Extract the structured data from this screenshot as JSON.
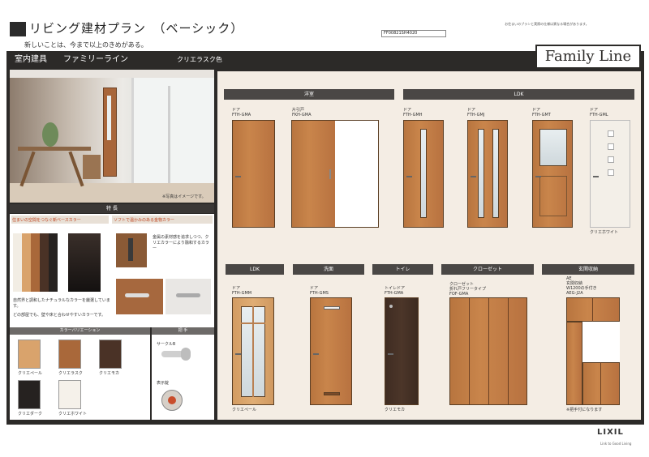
{
  "header": {
    "title": "リビング建材プラン　（ベーシック）",
    "subtitle": "新しいことは、今まで以上のきめがある。",
    "code": "FF00821SH4020",
    "note": "お住まいのプランと実際の仕様は異なる場合があります。"
  },
  "bar": {
    "category": "室内建具",
    "series": "ファミリーライン",
    "color": "クリエラスク色"
  },
  "logo": "Family Line",
  "photo_note": "※写真はイメージです。",
  "features": {
    "title": "特 長",
    "left_heading": "住まいの空間をつなぐ新ベースカラー",
    "right_heading": "ソフトで温かみのある金物カラー",
    "right_text": "金属の素材感を追求しつつ、クリエカラーにより融和するカラー",
    "left_text_1": "自然界と調和したナチュラルなカラーを厳選しています。",
    "left_text_2": "どの部屋でも、壁や床と合わせやすいカラーです。"
  },
  "color_variation": {
    "title": "カラーバリエーション",
    "swatches": [
      {
        "label": "クリエペール",
        "color": "#d9a36c"
      },
      {
        "label": "クリエラスク",
        "color": "#a9683a"
      },
      {
        "label": "クリエモカ",
        "color": "#4a3226"
      },
      {
        "label": "クリエダーク",
        "color": "#262220"
      },
      {
        "label": "クリエホワイト",
        "color": "#f5f1ea"
      }
    ]
  },
  "hardware": {
    "title": "把 手",
    "lever_label": "サークルB",
    "indicator_label": "表示錠"
  },
  "sections_top": [
    {
      "label": "洋室"
    },
    {
      "label": "LDK"
    }
  ],
  "sections_bottom": [
    {
      "label": "LDK"
    },
    {
      "label": "洗面"
    },
    {
      "label": "トイレ"
    },
    {
      "label": "クローゼット"
    },
    {
      "label": "玄関収納"
    }
  ],
  "doors_top": [
    {
      "type": "ドア",
      "model": "FTH-GMA"
    },
    {
      "type": "片引戸",
      "model": "FKH-GMA"
    },
    {
      "type": "ドア",
      "model": "FTH-GMH"
    },
    {
      "type": "ドア",
      "model": "FTH-GMJ"
    },
    {
      "type": "ドア",
      "model": "FTH-GMT"
    },
    {
      "type": "ドア",
      "model": "FTH-GML"
    }
  ],
  "white_door_note": "クリエホワイト",
  "doors_bottom": [
    {
      "type": "ドア",
      "model": "FTH-GMM",
      "note": "クリエペール"
    },
    {
      "type": "ドア",
      "model": "FTH-GMS",
      "note": ""
    },
    {
      "type": "トイレドア",
      "model": "FTH-GMA",
      "note": "クリエモカ"
    },
    {
      "type": "クローゼット\n折れ戸フリータイプ",
      "model": "FOF-GMA",
      "note": ""
    },
    {
      "type": "AE\n玄関収納\nW1200の手付き",
      "model": "AEG-J2A",
      "note": "※把手付になります"
    }
  ],
  "footer": {
    "brand": "LIXIL",
    "tagline": "Link to Good Living"
  }
}
